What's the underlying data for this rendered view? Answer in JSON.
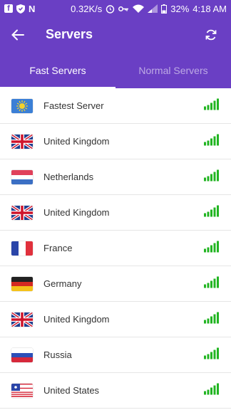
{
  "status_bar": {
    "speed": "0.32K/s",
    "battery": "32%",
    "time": "4:18 AM"
  },
  "header": {
    "title": "Servers"
  },
  "tabs": [
    {
      "label": "Fast Servers",
      "active": true
    },
    {
      "label": "Normal Servers",
      "active": false
    }
  ],
  "servers": [
    {
      "name": "Fastest Server",
      "flag": "fastest"
    },
    {
      "name": "United Kingdom",
      "flag": "uk"
    },
    {
      "name": "Netherlands",
      "flag": "nl"
    },
    {
      "name": "United Kingdom",
      "flag": "uk"
    },
    {
      "name": "France",
      "flag": "fr"
    },
    {
      "name": "Germany",
      "flag": "de"
    },
    {
      "name": "United Kingdom",
      "flag": "uk"
    },
    {
      "name": "Russia",
      "flag": "ru"
    },
    {
      "name": "United States",
      "flag": "us"
    }
  ],
  "colors": {
    "primary": "#6a3fc4",
    "signal": "#22b522"
  }
}
